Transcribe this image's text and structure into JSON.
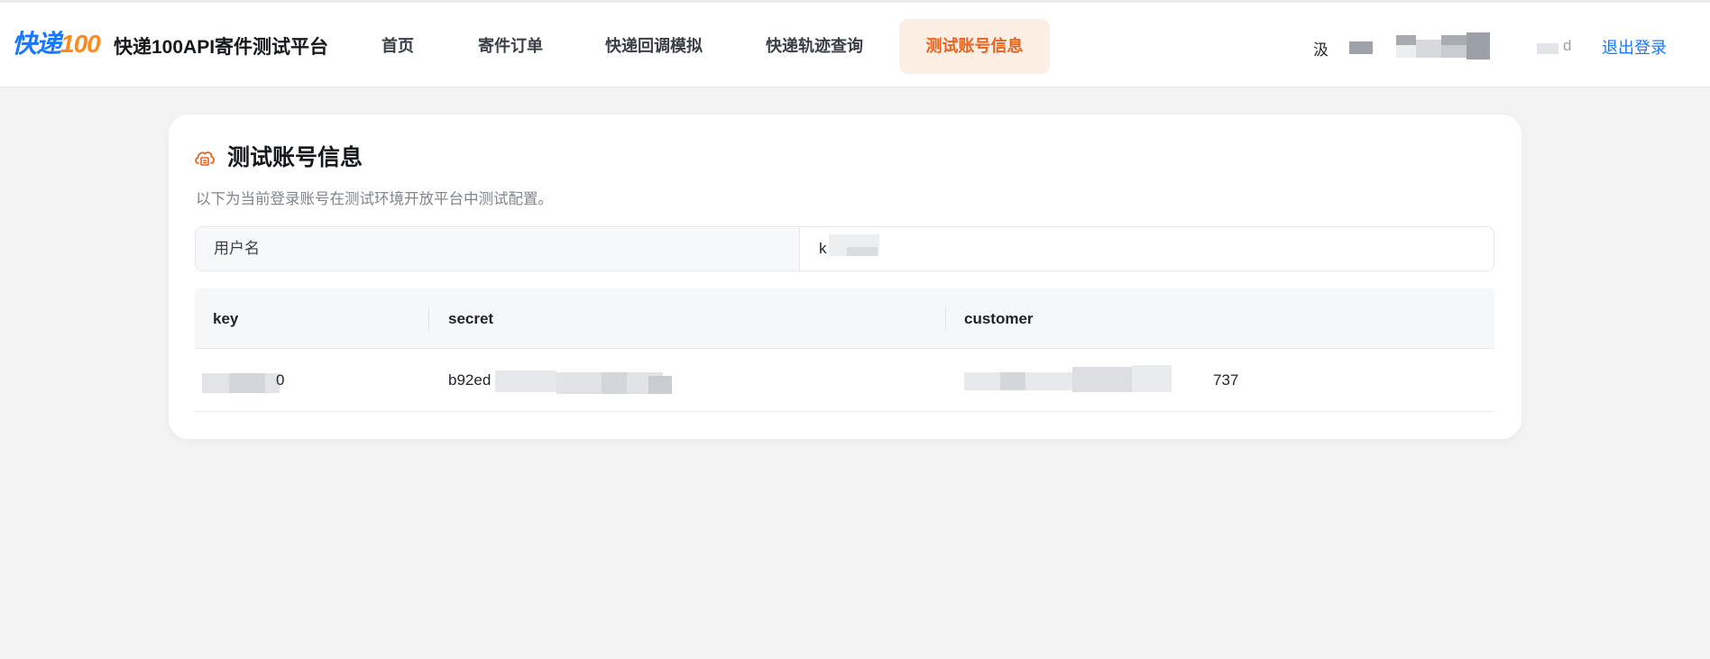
{
  "header": {
    "logo_text": "快递",
    "logo_num": "100",
    "brand": "快递100API寄件测试平台",
    "nav": [
      {
        "label": "首页",
        "active": false
      },
      {
        "label": "寄件订单",
        "active": false
      },
      {
        "label": "快递回调模拟",
        "active": false
      },
      {
        "label": "快递轨迹查询",
        "active": false
      },
      {
        "label": "测试账号信息",
        "active": true
      }
    ],
    "user_prefix": "汲",
    "user_suffix": "d",
    "logout": "退出登录"
  },
  "card": {
    "title": "测试账号信息",
    "icon": "cloud-service-icon",
    "description": "以下为当前登录账号在测试环境开放平台中测试配置。",
    "info": {
      "label": "用户名",
      "value": "k"
    },
    "table": {
      "columns": [
        "key",
        "secret",
        "customer"
      ],
      "rows": [
        {
          "key": "0",
          "secret": "b92ed",
          "customer": "737"
        }
      ]
    }
  },
  "colors": {
    "accent": "#e8641e",
    "accent_bg": "#fdeee4",
    "link": "#1677ff",
    "page_bg": "#f3f3f4"
  }
}
